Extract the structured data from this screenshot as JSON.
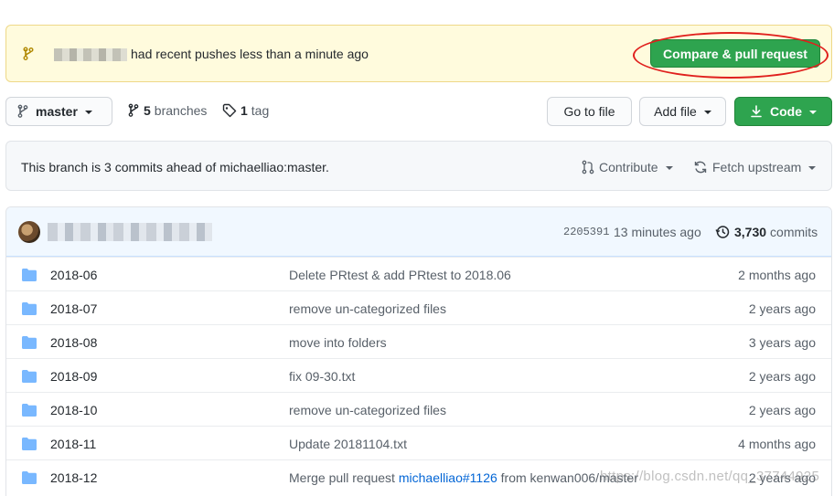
{
  "banner": {
    "message": "had recent pushes less than a minute ago",
    "button": "Compare & pull request"
  },
  "toolbar": {
    "branch": "master",
    "branches_count": "5",
    "branches_label": "branches",
    "tags_count": "1",
    "tags_label": "tag",
    "goto_file": "Go to file",
    "add_file": "Add file",
    "code": "Code"
  },
  "ahead": {
    "text": "This branch is 3 commits ahead of michaelliao:master.",
    "contribute": "Contribute",
    "fetch": "Fetch upstream"
  },
  "latest_commit": {
    "sha": "2205391",
    "time": "13 minutes ago",
    "commits_count": "3,730",
    "commits_label": "commits"
  },
  "files": [
    {
      "name": "2018-06",
      "message": "Delete PRtest & add PRtest to 2018.06",
      "age": "2 months ago"
    },
    {
      "name": "2018-07",
      "message": "remove un-categorized files",
      "age": "2 years ago"
    },
    {
      "name": "2018-08",
      "message": "move into folders",
      "age": "3 years ago"
    },
    {
      "name": "2018-09",
      "message": "fix 09-30.txt",
      "age": "2 years ago"
    },
    {
      "name": "2018-10",
      "message": "remove un-categorized files",
      "age": "2 years ago"
    },
    {
      "name": "2018-11",
      "message": "Update 20181104.txt",
      "age": "4 months ago"
    },
    {
      "name": "2018-12",
      "message_pre": "Merge pull request ",
      "message_link": "michaelliao#1126",
      "message_post": " from kenwan006/master",
      "age": "2 years ago"
    }
  ],
  "watermark": "https://blog.csdn.net/qq_37744925",
  "colors": {
    "green": "#2ea44f",
    "link": "#0366d6",
    "banner_bg": "#fffbdd",
    "highlight_ring": "#e0201d"
  }
}
